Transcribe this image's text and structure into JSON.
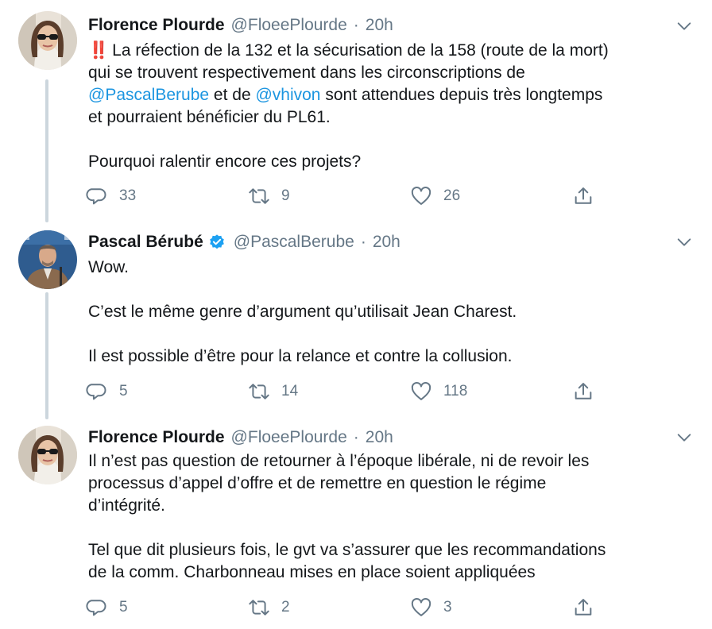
{
  "tweets": [
    {
      "name": "Florence Plourde",
      "handle": "@FloeePlourde",
      "separator": "·",
      "time": "20h",
      "verified": false,
      "emoji": "‼️",
      "lines": [
        [
          "La réfection de la 132 et la sécurisation de la 158 (route de la mort)"
        ],
        [
          "qui se trouvent respectivement dans les circonscriptions de"
        ],
        [
          "@PascalBerube",
          " et de ",
          "@vhivon",
          " sont attendues depuis très longtemps"
        ],
        [
          "et pourraient bénéficier du PL61."
        ],
        [],
        [
          "Pourquoi ralentir encore ces projets?"
        ]
      ],
      "replies": "33",
      "retweets": "9",
      "likes": "26"
    },
    {
      "name": "Pascal Bérubé",
      "handle": "@PascalBerube",
      "separator": "·",
      "time": "20h",
      "verified": true,
      "lines": [
        "Wow.",
        "",
        "C’est le même genre d’argument qu’utilisait Jean Charest.",
        "",
        "Il est possible d’être pour la relance et contre la collusion."
      ],
      "replies": "5",
      "retweets": "14",
      "likes": "118"
    },
    {
      "name": "Florence Plourde",
      "handle": "@FloeePlourde",
      "separator": "·",
      "time": "20h",
      "verified": false,
      "lines": [
        "Il n’est pas question de retourner à l’époque libérale, ni de revoir les",
        "processus d’appel d’offre et de remettre en question le régime",
        "d’intégrité.",
        "",
        "Tel que dit plusieurs fois, le gvt va s’assurer que les recommandations",
        "de la comm. Charbonneau mises en place soient appliquées"
      ],
      "replies": "5",
      "retweets": "2",
      "likes": "3"
    }
  ],
  "colors": {
    "text": "#14171a",
    "secondary": "#657786",
    "link": "#1b95e0",
    "verified": "#1da1f2",
    "thread_line": "#ccd6dd",
    "emoji": "#e0245e"
  },
  "icons": {
    "reply": "reply-icon",
    "retweet": "retweet-icon",
    "like": "heart-icon",
    "share": "share-icon",
    "menu": "chevron-down-icon",
    "verified": "verified-badge-icon"
  }
}
